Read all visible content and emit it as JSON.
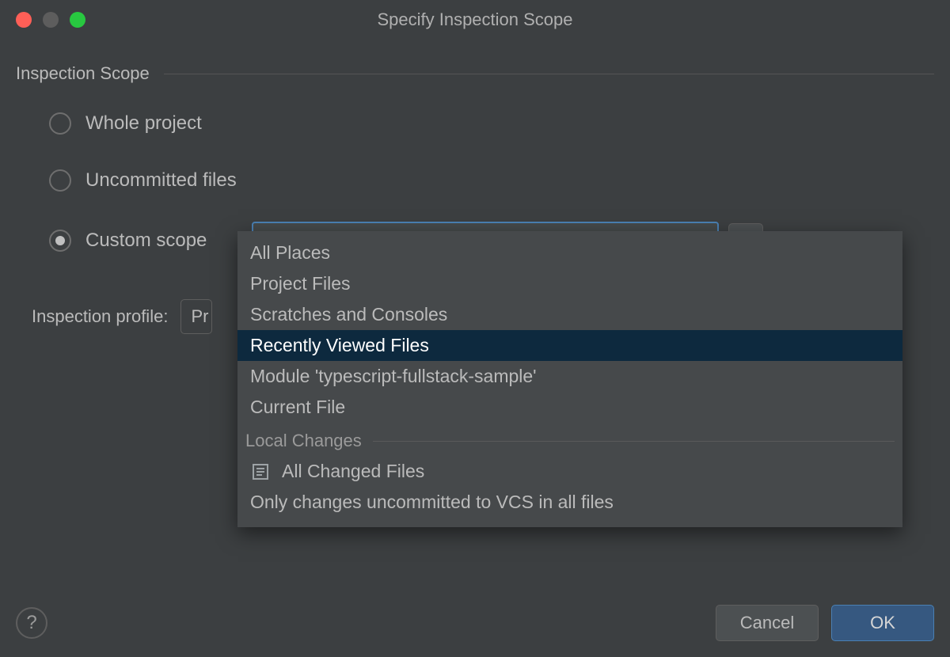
{
  "window": {
    "title": "Specify Inspection Scope"
  },
  "scope": {
    "group_title": "Inspection Scope",
    "options": {
      "whole_project": "Whole project",
      "uncommitted_files": "Uncommitted files",
      "custom_scope": "Custom scope"
    },
    "selected": "custom_scope",
    "custom_scope_value": "All Places",
    "ellipsis_label": "..."
  },
  "profile": {
    "label": "Inspection profile:",
    "value_truncated": "Pr"
  },
  "dropdown": {
    "items": [
      {
        "label": "All Places",
        "highlighted": false,
        "icon": null
      },
      {
        "label": "Project Files",
        "highlighted": false,
        "icon": null
      },
      {
        "label": "Scratches and Consoles",
        "highlighted": false,
        "icon": null
      },
      {
        "label": "Recently Viewed Files",
        "highlighted": true,
        "icon": null
      },
      {
        "label": "Module 'typescript-fullstack-sample'",
        "highlighted": false,
        "icon": null
      },
      {
        "label": "Current File",
        "highlighted": false,
        "icon": null
      }
    ],
    "section_label": "Local Changes",
    "section_items": [
      {
        "label": "All Changed Files",
        "highlighted": false,
        "icon": "changelist"
      },
      {
        "label": "Only changes uncommitted to VCS in all files",
        "highlighted": false,
        "icon": null
      }
    ]
  },
  "footer": {
    "help_tooltip": "?",
    "cancel": "Cancel",
    "ok": "OK"
  }
}
